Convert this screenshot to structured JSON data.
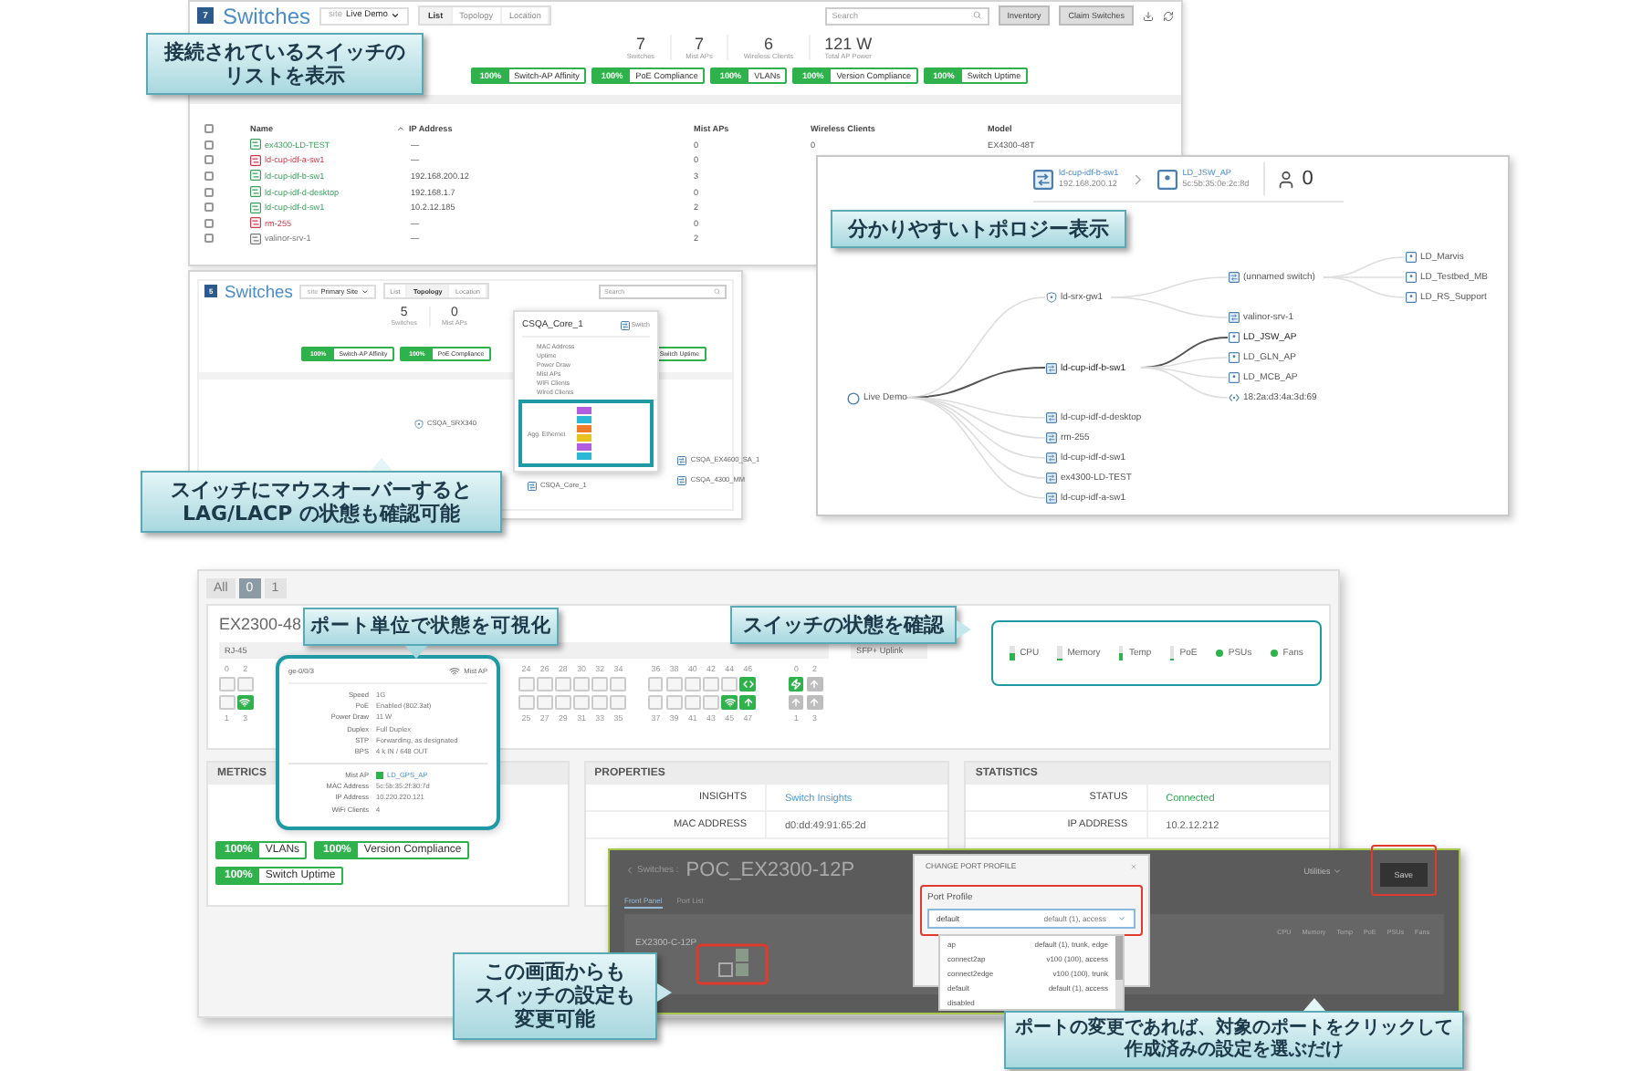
{
  "list_view": {
    "header": {
      "logo": "7",
      "title": "Switches",
      "site_label": "site",
      "site": "Live Demo",
      "view_tabs": [
        {
          "label": "List",
          "selected": true
        },
        {
          "label": "Topology",
          "selected": false
        },
        {
          "label": "Location",
          "selected": false
        }
      ],
      "search_placeholder": "Search",
      "buttons": [
        "Inventory",
        "Claim Switches"
      ]
    },
    "stats": [
      {
        "value": "7",
        "label": "Switches"
      },
      {
        "value": "7",
        "label": "Mist APs"
      },
      {
        "value": "6",
        "label": "Wireless Clients"
      },
      {
        "value": "121 W",
        "label": "Total AP Power"
      }
    ],
    "metrics": [
      {
        "pct": "100%",
        "label": "Switch-AP Affinity"
      },
      {
        "pct": "100%",
        "label": "PoE Compliance"
      },
      {
        "pct": "100%",
        "label": "VLANs"
      },
      {
        "pct": "100%",
        "label": "Version Compliance"
      },
      {
        "pct": "100%",
        "label": "Switch Uptime"
      }
    ],
    "select_all_checked": false,
    "columns": [
      "Name",
      "IP Address",
      "Mist APs",
      "Wireless Clients",
      "Model"
    ],
    "rows": [
      {
        "checked": false,
        "color": "#3a9d5d",
        "name": "ex4300-LD-TEST",
        "ip": "—",
        "mist_aps": "0",
        "wireless_clients": "0",
        "model": "EX4300-48T"
      },
      {
        "checked": false,
        "color": "#c8394a",
        "name": "ld-cup-idf-a-sw1",
        "ip": "—",
        "mist_aps": "0"
      },
      {
        "checked": false,
        "color": "#3a9d5d",
        "name": "ld-cup-idf-b-sw1",
        "ip": "192.168.200.12",
        "mist_aps": "3"
      },
      {
        "checked": false,
        "color": "#3a9d5d",
        "name": "ld-cup-idf-d-desktop",
        "ip": "192.168.1.7",
        "mist_aps": "0"
      },
      {
        "checked": false,
        "color": "#3a9d5d",
        "name": "ld-cup-idf-d-sw1",
        "ip": "10.2.12.185",
        "mist_aps": "2"
      },
      {
        "checked": false,
        "color": "#c8394a",
        "name": "rm-255",
        "ip": "—",
        "mist_aps": "0"
      },
      {
        "checked": false,
        "color": "#777777",
        "name": "valinor-srv-1",
        "ip": "—",
        "mist_aps": "2"
      }
    ]
  },
  "topology_view": {
    "breadcrumb": [
      {
        "kind": "switch",
        "name": "ld-cup-idf-b-sw1",
        "detail": "192.168.200.12"
      },
      {
        "kind": "ap",
        "name": "LD_JSW_AP",
        "detail": "5c:5b:35:0e:2c:8d"
      }
    ],
    "clients": "0",
    "root": {
      "kind": "site",
      "label": "Live Demo",
      "children": [
        {
          "kind": "gateway",
          "label": "ld-srx-gw1",
          "on_path": false,
          "children": [
            {
              "kind": "switch",
              "label": "(unnamed switch)",
              "on_path": false,
              "children": [
                {
                  "kind": "ap",
                  "label": "LD_Marvis",
                  "on_path": false
                },
                {
                  "kind": "ap",
                  "label": "LD_Testbed_MB",
                  "on_path": false
                },
                {
                  "kind": "ap",
                  "label": "LD_RS_Support",
                  "on_path": false
                }
              ]
            },
            {
              "kind": "switch",
              "label": "valinor-srv-1",
              "on_path": false
            }
          ]
        },
        {
          "kind": "switch",
          "label": "ld-cup-idf-b-sw1",
          "on_path": true,
          "children": [
            {
              "kind": "ap",
              "label": "LD_JSW_AP",
              "on_path": true
            },
            {
              "kind": "ap",
              "label": "LD_GLN_AP",
              "on_path": false
            },
            {
              "kind": "ap",
              "label": "LD_MCB_AP",
              "on_path": false
            },
            {
              "kind": "client",
              "label": "18:2a:d3:4a:3d:69",
              "on_path": false
            }
          ]
        },
        {
          "kind": "switch",
          "label": "ld-cup-idf-d-desktop",
          "on_path": false
        },
        {
          "kind": "switch",
          "label": "rm-255",
          "on_path": false
        },
        {
          "kind": "switch",
          "label": "ld-cup-idf-d-sw1",
          "on_path": false
        },
        {
          "kind": "switch",
          "label": "ex4300-LD-TEST",
          "on_path": false
        },
        {
          "kind": "switch",
          "label": "ld-cup-idf-a-sw1",
          "on_path": false
        }
      ]
    }
  },
  "hover_view": {
    "header": {
      "logo": "5",
      "title": "Switches",
      "site_label": "site",
      "site": "Primary Site",
      "view_tabs": [
        {
          "label": "List",
          "selected": false
        },
        {
          "label": "Topology",
          "selected": true
        },
        {
          "label": "Location",
          "selected": false
        }
      ],
      "search_placeholder": "Search"
    },
    "stats": [
      {
        "value": "5",
        "label": "Switches"
      },
      {
        "value": "0",
        "label": "Mist APs"
      }
    ],
    "metrics": [
      {
        "pct": "100%",
        "label": "Switch-AP Affinity"
      },
      {
        "pct": "100%",
        "label": "PoE Compliance"
      },
      {
        "label": "Switch Uptime"
      }
    ],
    "tooltip": {
      "title": "CSQA_Core_1",
      "type": "Switch",
      "fields": [
        "MAC Address",
        "Uptime",
        "Power Draw",
        "Mist APs",
        "WiFi Clients",
        "Wired Clients"
      ],
      "agg_label": "Agg. Ethernet",
      "lags": [
        {
          "color": "#b05de0"
        },
        {
          "color": "#2bb8d6"
        },
        {
          "color": "#f07c2a"
        },
        {
          "color": "#e8c21c"
        },
        {
          "color": "#b05de0"
        },
        {
          "color": "#2bb8d6"
        }
      ]
    },
    "nodes": [
      {
        "kind": "gateway",
        "label": "CSQA_SRX340"
      },
      {
        "kind": "switch",
        "label": "CSQA_Core_1"
      },
      {
        "kind": "switch",
        "label": "CSQA_EX4600_SA_1"
      },
      {
        "kind": "switch",
        "label": "CSQA_4300_MM"
      }
    ]
  },
  "device_view": {
    "member_tabs": [
      {
        "label": "All",
        "selected": false
      },
      {
        "label": "0",
        "selected": true
      },
      {
        "label": "1",
        "selected": false
      }
    ],
    "model": "EX2300-48",
    "rj45_label": "RJ-45",
    "uplink_label": "SFP+ Uplink",
    "port_groups": [
      [
        {
          "top": {
            "number": "0",
            "kind": "empty"
          },
          "bottom": {
            "number": "1",
            "kind": "empty"
          }
        },
        {
          "top": {
            "number": "2",
            "kind": "empty"
          },
          "bottom": {
            "number": "3",
            "kind": "ap"
          }
        }
      ],
      [
        {
          "top": {
            "number": "24",
            "kind": "empty"
          },
          "bottom": {
            "number": "25",
            "kind": "empty"
          }
        },
        {
          "top": {
            "number": "26",
            "kind": "empty"
          },
          "bottom": {
            "number": "27",
            "kind": "empty"
          }
        },
        {
          "top": {
            "number": "28",
            "kind": "empty"
          },
          "bottom": {
            "number": "29",
            "kind": "empty"
          }
        },
        {
          "top": {
            "number": "30",
            "kind": "empty"
          },
          "bottom": {
            "number": "31",
            "kind": "empty"
          }
        },
        {
          "top": {
            "number": "32",
            "kind": "empty"
          },
          "bottom": {
            "number": "33",
            "kind": "empty"
          }
        },
        {
          "top": {
            "number": "34",
            "kind": "empty"
          },
          "bottom": {
            "number": "35",
            "kind": "empty"
          }
        }
      ],
      [
        {
          "top": {
            "number": "36",
            "kind": "empty"
          },
          "bottom": {
            "number": "37",
            "kind": "empty"
          }
        },
        {
          "top": {
            "number": "38",
            "kind": "empty"
          },
          "bottom": {
            "number": "39",
            "kind": "empty"
          }
        },
        {
          "top": {
            "number": "40",
            "kind": "empty"
          },
          "bottom": {
            "number": "41",
            "kind": "empty"
          }
        },
        {
          "top": {
            "number": "42",
            "kind": "empty"
          },
          "bottom": {
            "number": "43",
            "kind": "empty"
          }
        },
        {
          "top": {
            "number": "44",
            "kind": "empty"
          },
          "bottom": {
            "number": "45",
            "kind": "ap"
          }
        },
        {
          "top": {
            "number": "46",
            "kind": "link"
          },
          "bottom": {
            "number": "47",
            "kind": "uplink"
          }
        }
      ]
    ],
    "uplink_ports": [
      {
        "top": {
          "number": "0",
          "kind": "power"
        },
        "bottom": {
          "number": "1",
          "kind": "uplink-off"
        }
      },
      {
        "top": {
          "number": "2",
          "kind": "uplink-off"
        },
        "bottom": {
          "number": "3",
          "kind": "uplink-off"
        }
      }
    ],
    "health": [
      {
        "kind": "bar",
        "label": "CPU",
        "level": 0.45
      },
      {
        "kind": "bar",
        "label": "Memory",
        "level": 0.15
      },
      {
        "kind": "bar",
        "label": "Temp",
        "level": 0.45
      },
      {
        "kind": "bar",
        "label": "PoE",
        "level": 0.1
      },
      {
        "kind": "dot",
        "label": "PSUs",
        "ok": true
      },
      {
        "kind": "dot",
        "label": "Fans",
        "ok": true
      }
    ],
    "port_tooltip": {
      "port": "ge-0/0/3",
      "device": "Mist AP",
      "fields": [
        {
          "key": "Speed",
          "value": "1G"
        },
        {
          "key": "PoE",
          "value": "Enabled (802.3at)"
        },
        {
          "key": "Power Draw",
          "value": "11 W"
        },
        {
          "key": "Duplex",
          "value": "Full Duplex"
        },
        {
          "key": "STP",
          "value": "Forwarding, as designated"
        },
        {
          "key": "BPS",
          "value": "4 k IN / 648 OUT"
        }
      ],
      "ap_fields": [
        {
          "key": "Mist AP",
          "value": "LD_GPS_AP",
          "kind": "link"
        },
        {
          "key": "MAC Address",
          "value": "5c:5b:35:2f:30:7d",
          "kind": "text"
        },
        {
          "key": "IP Address",
          "value": "10.220.220.121",
          "kind": "text"
        },
        {
          "key": "WiFi Clients",
          "value": "4",
          "kind": "text"
        }
      ]
    },
    "metrics_title": "METRICS",
    "metrics": [
      {
        "pct": "100%",
        "label": "VLANs"
      },
      {
        "pct": "100%",
        "label": "Version Compliance"
      },
      {
        "pct": "100%",
        "label": "Switch Uptime"
      }
    ],
    "properties": {
      "title": "PROPERTIES",
      "rows": [
        {
          "key": "INSIGHTS",
          "value": "Switch Insights",
          "kind": "link"
        },
        {
          "key": "MAC ADDRESS",
          "value": "d0:dd:49:91:65:2d",
          "kind": "text"
        }
      ]
    },
    "statistics": {
      "title": "STATISTICS",
      "rows": [
        {
          "key": "STATUS",
          "value": "Connected",
          "kind": "status"
        },
        {
          "key": "IP ADDRESS",
          "value": "10.2.12.212",
          "kind": "text"
        }
      ]
    }
  },
  "config_view": {
    "back_label": "Switches :",
    "title": "POC_EX2300-12P",
    "tabs": [
      {
        "label": "Front Panel",
        "selected": true
      },
      {
        "label": "Port List",
        "selected": false
      }
    ],
    "model": "EX2300-C-12P",
    "utilities": "Utilities",
    "save": "Save",
    "health_labels": [
      "CPU",
      "Memory",
      "Temp",
      "PoE",
      "PSUs",
      "Fans"
    ],
    "modal": {
      "title": "CHANGE PORT PROFILE",
      "field_label": "Port Profile",
      "value": "default",
      "value_detail": "default (1), access",
      "options": [
        {
          "name": "ap",
          "detail": "default (1), trunk, edge"
        },
        {
          "name": "connect2ap",
          "detail": "v100 (100), access"
        },
        {
          "name": "connect2edge",
          "detail": "v100 (100), trunk"
        },
        {
          "name": "default",
          "detail": "default (1), access"
        },
        {
          "name": "disabled"
        }
      ]
    }
  },
  "callouts": [
    {
      "lines": [
        "接続されているスイッチの",
        "リストを表示"
      ]
    },
    {
      "lines": [
        "分かりやすいトポロジー表示"
      ]
    },
    {
      "lines": [
        "スイッチにマウスオーバーすると",
        "LAG/LACP の状態も確認可能"
      ]
    },
    {
      "lines": [
        "ポート単位で状態を可視化"
      ]
    },
    {
      "lines": [
        "スイッチの状態を確認"
      ]
    },
    {
      "lines": [
        "この画面からも",
        "スイッチの設定も",
        "変更可能"
      ]
    },
    {
      "lines": [
        "ポートの変更であれば、対象のポートをクリックして",
        "作成済みの設定を選ぶだけ"
      ]
    }
  ]
}
